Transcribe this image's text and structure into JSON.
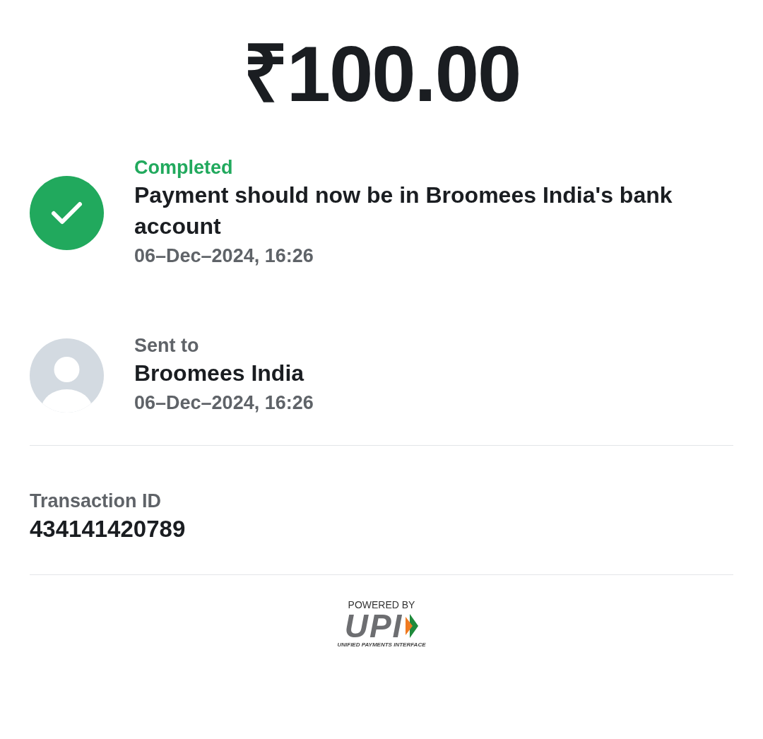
{
  "amount": "₹100.00",
  "events": [
    {
      "kind": "status",
      "label": "Completed",
      "text": "Payment should now be in Broomees India's bank account",
      "time": "06–Dec–2024, 16:26"
    },
    {
      "kind": "recipient",
      "label": "Sent to",
      "text": "Broomees India",
      "time": "06–Dec–2024, 16:26"
    }
  ],
  "transaction": {
    "label": "Transaction ID",
    "value": "434141420789"
  },
  "footer": {
    "powered_by": "POWERED BY",
    "logo": "UPI",
    "tagline": "UNIFIED PAYMENTS INTERFACE"
  }
}
